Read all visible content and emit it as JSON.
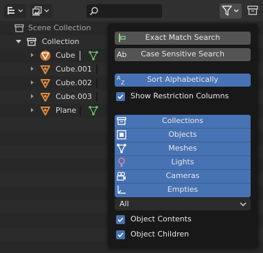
{
  "header": {
    "display_mode_icon": "outliner-display-icon",
    "filter_type_icon": "image-filter-icon",
    "search": {
      "placeholder": "",
      "value": "",
      "icon": "search-icon"
    },
    "filter_icon": "funnel-icon"
  },
  "outliner": {
    "scene_collection": "Scene Collection",
    "collection": "Collection",
    "objects": [
      {
        "name": "Cube",
        "icon": "mesh-object-icon",
        "extra": "mesh-data-icon"
      },
      {
        "name": "Cube.001",
        "icon": "mesh-object-icon"
      },
      {
        "name": "Cube.002",
        "icon": "mesh-object-icon"
      },
      {
        "name": "Cube.003",
        "icon": "mesh-object-icon"
      },
      {
        "name": "Plane",
        "icon": "mesh-object-icon",
        "extra": "mesh-data-icon"
      }
    ]
  },
  "popover": {
    "exact_match": "Exact Match Search",
    "case_sensitive": "Case Sensitive Search",
    "sort_alpha": "Sort Alphabetically",
    "show_restriction": "Show Restriction Columns",
    "filters": [
      "Collections",
      "Objects",
      "Meshes",
      "Lights",
      "Cameras",
      "Empties"
    ],
    "object_type_select": "All",
    "object_contents": "Object Contents",
    "object_children": "Object Children"
  },
  "colors": {
    "accent": "#4772b3",
    "button": "#545454",
    "popover_bg": "#181818",
    "object_orange": "#e08a3c"
  }
}
